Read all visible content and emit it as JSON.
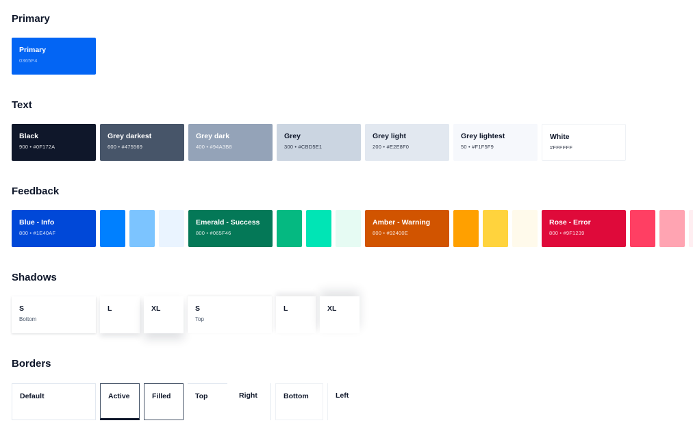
{
  "sections": {
    "primary": "Primary",
    "text": "Text",
    "feedback": "Feedback",
    "shadows": "Shadows",
    "borders": "Borders"
  },
  "primary": {
    "name": "Primary",
    "code": "0365F4",
    "color": "#0365F4"
  },
  "text_colors": [
    {
      "name": "Black",
      "code": "900 • #0F172A",
      "color": "#0F172A"
    },
    {
      "name": "Grey darkest",
      "code": "600 • #475569",
      "color": "#475569"
    },
    {
      "name": "Grey dark",
      "code": "400 • #94A3B8",
      "color": "#94A3B8"
    },
    {
      "name": "Grey",
      "code": "300 • #CBD5E1",
      "color": "#CBD5E1"
    },
    {
      "name": "Grey light",
      "code": "200 • #E2E8F0",
      "color": "#E2E8F0"
    },
    {
      "name": "Grey lightest",
      "code": "50 • #F1F5F9",
      "color": "#F1F5F9"
    },
    {
      "name": "White",
      "code": "#FFFFFF",
      "color": "#FFFFFF"
    }
  ],
  "feedback": [
    {
      "name": "Blue - Info",
      "code": "800 • #1E40AF",
      "color": "#0048D8",
      "shades": [
        "#0080FF",
        "#7CC4FF",
        "#EAF4FF"
      ]
    },
    {
      "name": "Emerald - Success",
      "code": "800 • #065F46",
      "color": "#047857",
      "shades": [
        "#05B981",
        "#00E5B5",
        "#E6FBF3"
      ]
    },
    {
      "name": "Amber - Warning",
      "code": "800 • #92400E",
      "color": "#D15400",
      "shades": [
        "#FFA000",
        "#FFD33D",
        "#FFFAEB"
      ]
    },
    {
      "name": "Rose - Error",
      "code": "800 • #9F1239",
      "color": "#DF0A3A",
      "shades": [
        "#FF3F63",
        "#FFA4B2",
        "#FFEEF1"
      ]
    }
  ],
  "shadows": [
    {
      "name": "S",
      "sub": "Bottom"
    },
    {
      "name": "L",
      "sub": ""
    },
    {
      "name": "XL",
      "sub": ""
    },
    {
      "name": "S",
      "sub": "Top"
    },
    {
      "name": "L",
      "sub": ""
    },
    {
      "name": "XL",
      "sub": ""
    }
  ],
  "borders": [
    {
      "name": "Default"
    },
    {
      "name": "Active"
    },
    {
      "name": "Filled"
    },
    {
      "name": "Top"
    },
    {
      "name": "Right"
    },
    {
      "name": "Bottom"
    },
    {
      "name": "Left"
    }
  ]
}
